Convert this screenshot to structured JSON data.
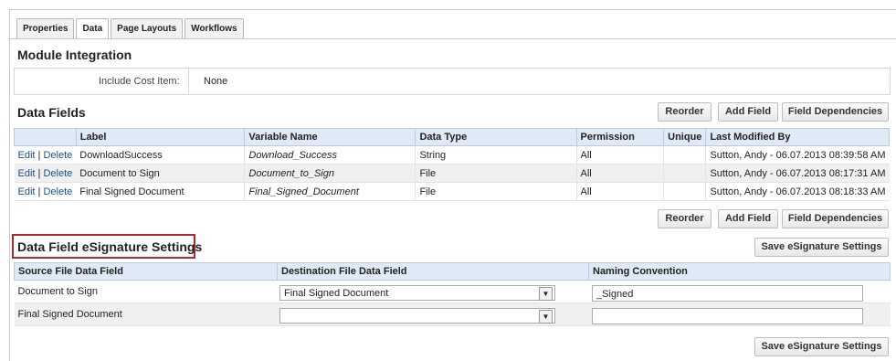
{
  "tabs": [
    "Properties",
    "Data",
    "Page Layouts",
    "Workflows"
  ],
  "module_integration": {
    "title": "Module Integration",
    "include_cost_label": "Include Cost Item:",
    "include_cost_value": "None"
  },
  "data_fields": {
    "title": "Data Fields",
    "buttons": {
      "reorder": "Reorder",
      "add_field": "Add Field",
      "dependencies": "Field Dependencies"
    },
    "columns": [
      "Label",
      "Variable Name",
      "Data Type",
      "Permission",
      "Unique",
      "Last Modified By"
    ],
    "edit_label": "Edit",
    "delete_label": "Delete",
    "rows": [
      {
        "label": "DownloadSuccess",
        "variable": "Download_Success",
        "type": "String",
        "permission": "All",
        "unique": "",
        "modified": "Sutton, Andy - 06.07.2013 08:39:58 AM"
      },
      {
        "label": "Document to Sign",
        "variable": "Document_to_Sign",
        "type": "File",
        "permission": "All",
        "unique": "",
        "modified": "Sutton, Andy - 06.07.2013 08:17:31 AM"
      },
      {
        "label": "Final Signed Document",
        "variable": "Final_Signed_Document",
        "type": "File",
        "permission": "All",
        "unique": "",
        "modified": "Sutton, Andy - 06.07.2013 08:18:33 AM"
      }
    ]
  },
  "esignature": {
    "title": "Data Field eSignature Settings",
    "save_label": "Save eSignature Settings",
    "columns": [
      "Source File Data Field",
      "Destination File Data Field",
      "Naming Convention"
    ],
    "rows": [
      {
        "source": "Document to Sign",
        "destination": "Final Signed Document",
        "naming": "_Signed"
      },
      {
        "source": "Final Signed Document",
        "destination": "",
        "naming": ""
      }
    ]
  },
  "colors": {
    "header_bg": "#dfeaf6",
    "highlight_border": "#b0272d",
    "link": "#1a4f8a"
  }
}
